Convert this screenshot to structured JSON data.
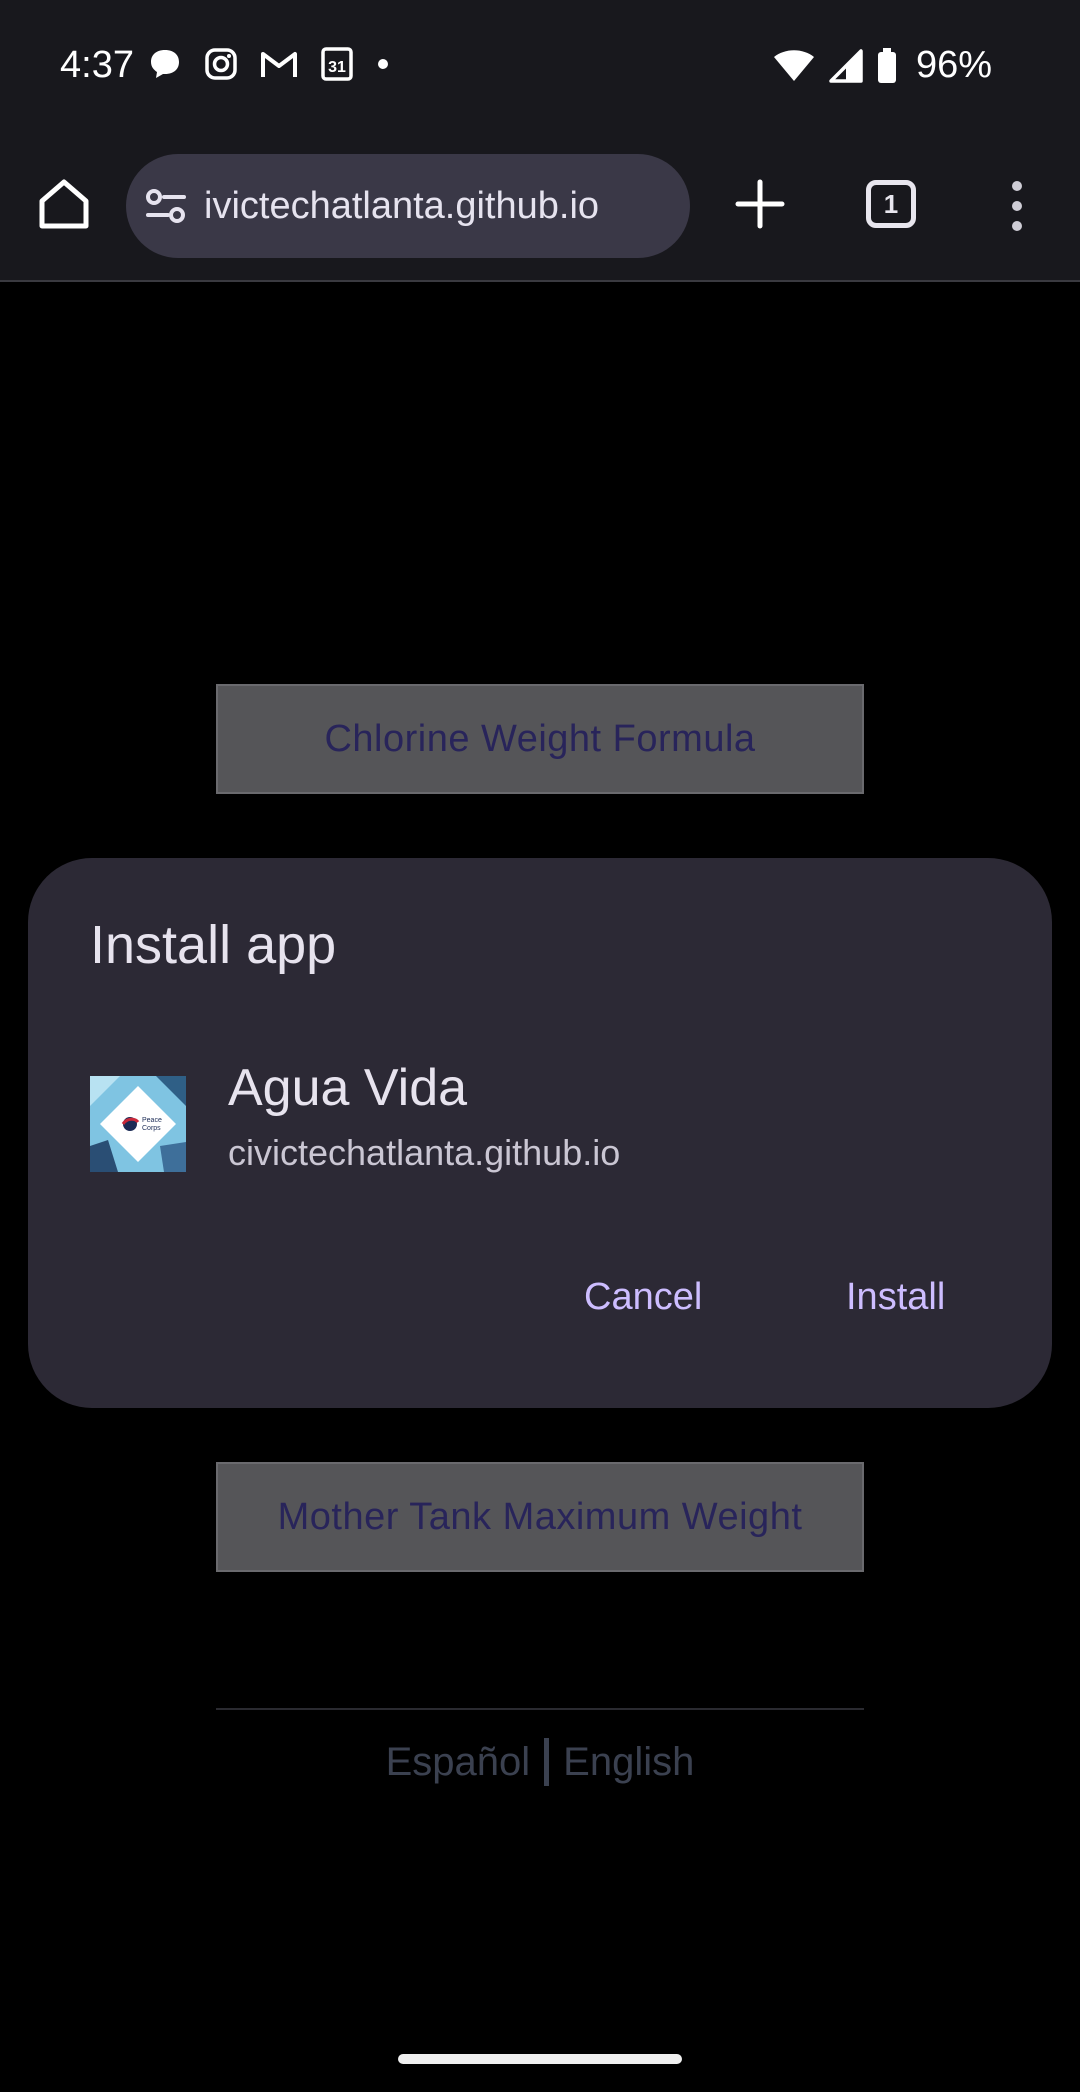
{
  "status_bar": {
    "time": "4:37",
    "battery": "96%",
    "notification_icons": [
      "chat-bubble-icon",
      "instagram-icon",
      "gmail-icon",
      "calendar-icon",
      "dot-icon"
    ],
    "calendar_day": "31"
  },
  "browser": {
    "url": "ivictechatlanta.github.io",
    "tab_count": "1"
  },
  "page": {
    "chlorine_button": "Chlorine Weight Formula",
    "mother_tank_button": "Mother Tank Maximum Weight",
    "lang_es": "Español",
    "lang_en": "English"
  },
  "dialog": {
    "title": "Install app",
    "app_name": "Agua Vida",
    "app_url": "civictechatlanta.github.io",
    "icon_label_line1": "Peace",
    "icon_label_line2": "Corps",
    "cancel_label": "Cancel",
    "install_label": "Install",
    "accent_color": "#cdbdff"
  }
}
